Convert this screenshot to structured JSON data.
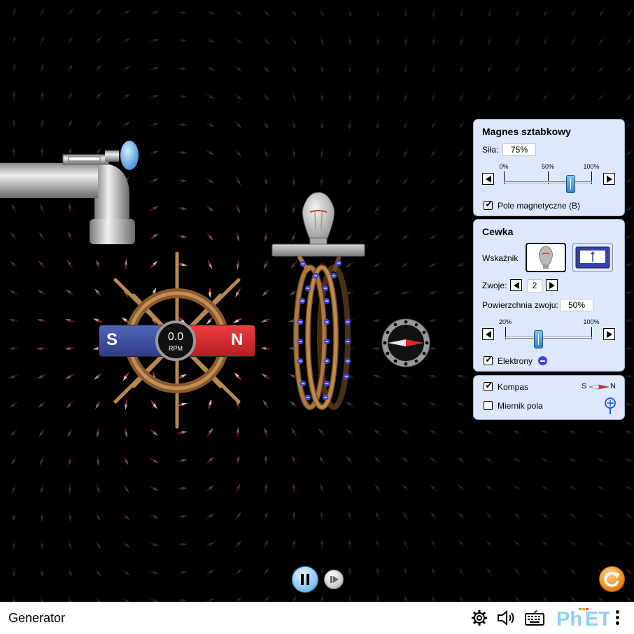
{
  "app": {
    "title": "Generator"
  },
  "magnet": {
    "south": "S",
    "north": "N"
  },
  "rpm": {
    "value": "0.0",
    "unit": "RPM"
  },
  "bar_magnet_panel": {
    "title": "Magnes sztabkowy",
    "strength_label": "Siła:",
    "strength_value": "75%",
    "strength_fraction": 0.75,
    "ticks": [
      "0%",
      "50%",
      "100%"
    ],
    "field_checkbox_label": "Pole magnetyczne (B)",
    "field_checked": true
  },
  "coil_panel": {
    "title": "Cewka",
    "indicator_label": "Wskaźnik",
    "loops_label": "Zwoje:",
    "loops_value": "2",
    "area_label": "Powierzchnia zwoju:",
    "area_value": "50%",
    "area_fraction": 0.5,
    "area_ticks": [
      "20%",
      "100%"
    ],
    "electrons_label": "Elektrony",
    "electrons_checked": true
  },
  "tools_panel": {
    "compass_label": "Kompas",
    "compass_checked": true,
    "compass_s": "S",
    "compass_n": "N",
    "field_meter_label": "Miernik pola",
    "field_meter_checked": false
  },
  "colors": {
    "panel_bg": "#dde8ff",
    "magnet_south": "#34489a",
    "magnet_north": "#d9262b",
    "coil": "#b07a3e",
    "electron": "#3c45d6",
    "phet_accent": "#f5a623"
  }
}
